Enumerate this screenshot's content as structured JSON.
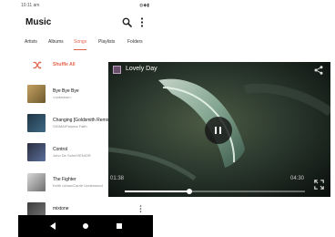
{
  "status_bar": {
    "time": "10:11 am",
    "icons": "◍◆▮"
  },
  "app": {
    "title": "Music"
  },
  "tabs": [
    {
      "label": "Artists",
      "active": false
    },
    {
      "label": "Albums",
      "active": false
    },
    {
      "label": "Songs",
      "active": true
    },
    {
      "label": "Playlists",
      "active": false
    },
    {
      "label": "Folders",
      "active": false
    }
  ],
  "shuffle": {
    "label": "Shuffle All",
    "icon": "shuffle-icon"
  },
  "songs": [
    {
      "title": "Bye Bye Bye",
      "artist": "<unknown>",
      "art_colors": [
        "#c4a062",
        "#6e5a2c"
      ]
    },
    {
      "title": "Changing [Goldsmith Remix]",
      "artist": "SIGMA/Paloma Faith",
      "art_colors": [
        "#1f3545",
        "#3f6a85"
      ]
    },
    {
      "title": "Control",
      "artist": "John De Sohn/VENIOR",
      "art_colors": [
        "#2a2f3d",
        "#5b6e9c"
      ]
    },
    {
      "title": "The Fighter",
      "artist": "Keith Urban/Carrie Underwood",
      "art_colors": [
        "#d8d8d8",
        "#6e6e6e"
      ]
    },
    {
      "title": "mixtone",
      "artist": "",
      "art_colors": [
        "#3b3b3b",
        "#7a7a7a"
      ]
    }
  ],
  "player": {
    "title": "Lovely Day",
    "elapsed": "01:38",
    "total": "04:30",
    "progress_fraction": 0.36,
    "state": "playing"
  },
  "colors": {
    "accent": "#e5634d"
  }
}
